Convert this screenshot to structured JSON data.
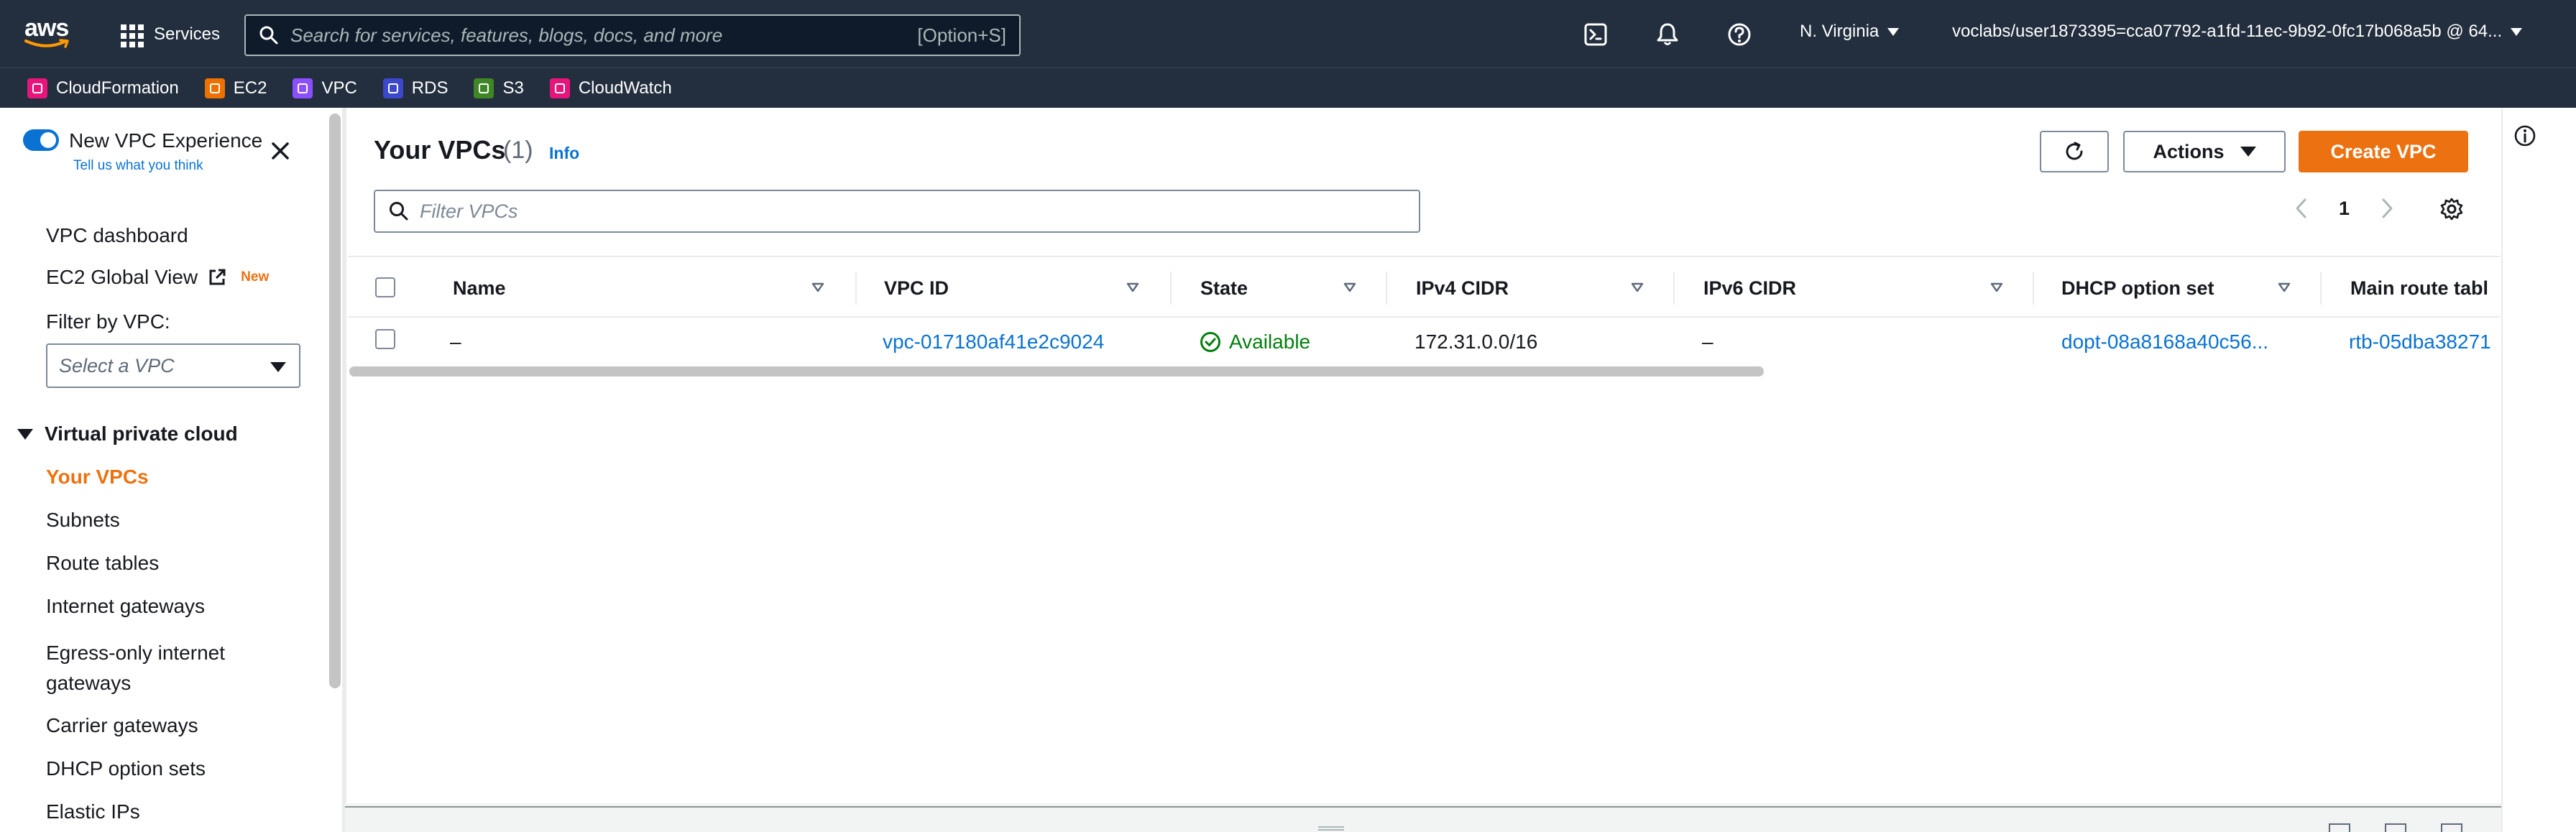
{
  "topnav": {
    "logo_text": "aws",
    "services_label": "Services",
    "search_placeholder": "Search for services, features, blogs, docs, and more",
    "search_shortcut": "[Option+S]",
    "region": "N. Virginia",
    "account": "voclabs/user1873395=cca07792-a1fd-11ec-9b92-0fc17b068a5b @ 64..."
  },
  "favorites": [
    {
      "label": "CloudFormation",
      "color": "#e7157b"
    },
    {
      "label": "EC2",
      "color": "#ed7100"
    },
    {
      "label": "VPC",
      "color": "#8c4fff"
    },
    {
      "label": "RDS",
      "color": "#3b48cc"
    },
    {
      "label": "S3",
      "color": "#3f8624"
    },
    {
      "label": "CloudWatch",
      "color": "#e7157b"
    }
  ],
  "sidebar": {
    "toggle_label": "New VPC Experience",
    "feedback_link": "Tell us what you think",
    "links_top": [
      {
        "label": "VPC dashboard"
      },
      {
        "label": "EC2 Global View",
        "badge": "New"
      }
    ],
    "filter_label": "Filter by VPC:",
    "filter_placeholder": "Select a VPC",
    "section_title": "Virtual private cloud",
    "section_items": [
      {
        "label": "Your VPCs",
        "active": true
      },
      {
        "label": "Subnets"
      },
      {
        "label": "Route tables"
      },
      {
        "label": "Internet gateways"
      },
      {
        "label": "Egress-only internet gateways"
      },
      {
        "label": "Carrier gateways"
      },
      {
        "label": "DHCP option sets"
      },
      {
        "label": "Elastic IPs"
      }
    ]
  },
  "main": {
    "title": "Your VPCs",
    "count": "(1)",
    "info": "Info",
    "actions_label": "Actions",
    "create_label": "Create VPC",
    "filter_placeholder": "Filter VPCs",
    "page": "1",
    "columns": [
      "Name",
      "VPC ID",
      "State",
      "IPv4 CIDR",
      "IPv6 CIDR",
      "DHCP option set",
      "Main route tabl"
    ],
    "rows": [
      {
        "name": "–",
        "vpc_id": "vpc-017180af41e2c9024",
        "state": "Available",
        "ipv4": "172.31.0.0/16",
        "ipv6": "–",
        "dhcp": "dopt-08a8168a40c56...",
        "route_table": "rtb-05dba38271"
      }
    ]
  },
  "colors": {
    "nav_bg": "#232f3e",
    "accent": "#ec7211",
    "link": "#0972d3",
    "success": "#037f0c"
  }
}
